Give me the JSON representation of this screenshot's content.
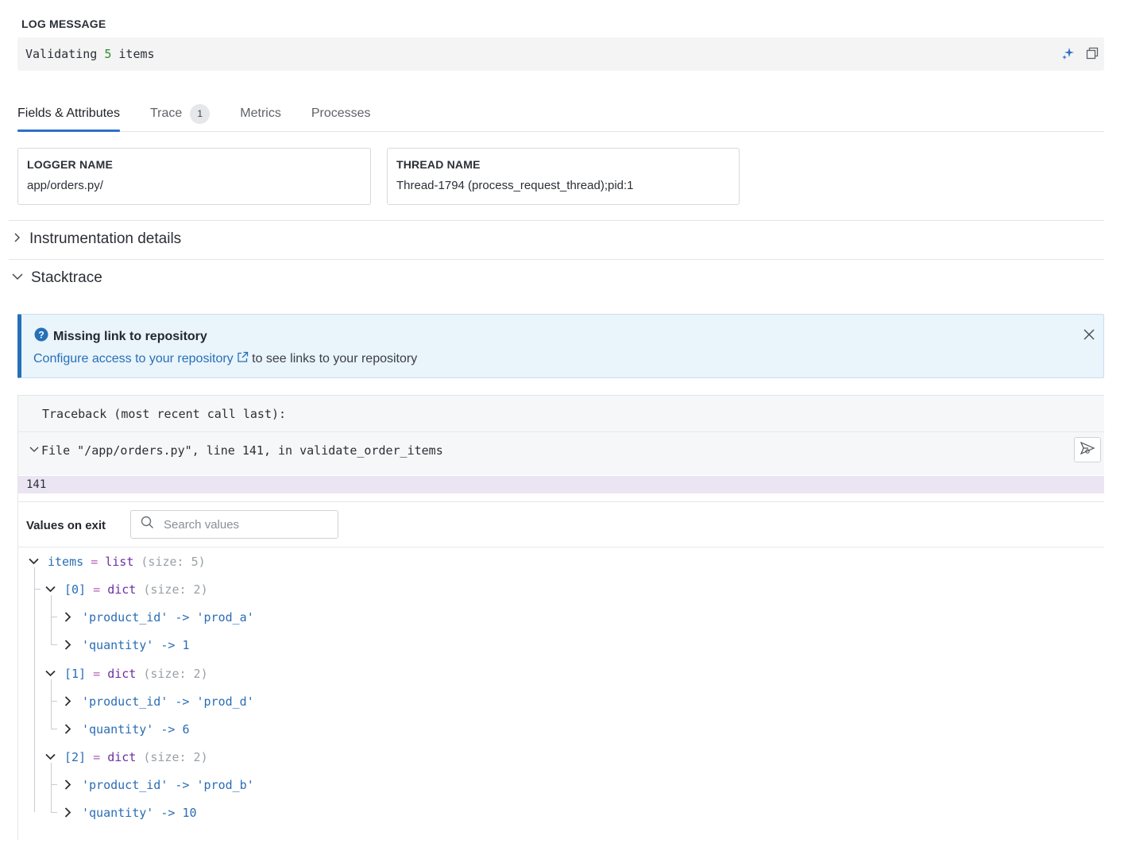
{
  "log": {
    "heading": "LOG MESSAGE",
    "prefix": "Validating ",
    "count": "5",
    "suffix": " items",
    "actions": [
      "sparkle-icon",
      "copy-icon"
    ]
  },
  "tabs": [
    {
      "label": "Fields & Attributes",
      "active": true
    },
    {
      "label": "Trace",
      "badge": "1"
    },
    {
      "label": "Metrics"
    },
    {
      "label": "Processes"
    }
  ],
  "fields": {
    "logger": {
      "label": "LOGGER NAME",
      "value": "app/orders.py/"
    },
    "thread": {
      "label": "THREAD NAME",
      "value": "Thread-1794 (process_request_thread);pid:1"
    }
  },
  "sections": {
    "instrumentation": "Instrumentation details",
    "stacktrace": "Stacktrace"
  },
  "banner": {
    "title": "Missing link to repository",
    "link": "Configure access to your repository",
    "rest": " to see links to your repository"
  },
  "stack": {
    "traceback": "Traceback (most recent call last):",
    "file": "File \"/app/orders.py\", line 141, in validate_order_items",
    "line_no": "141",
    "values_label": "Values on exit",
    "search_placeholder": "Search values"
  },
  "tree": {
    "root": {
      "name": "items",
      "eq": "=",
      "type": "list",
      "meta": "(size: 5)"
    },
    "entries": [
      {
        "index": "[0]",
        "eq": "=",
        "type": "dict",
        "meta": "(size: 2)",
        "kv": [
          {
            "key": "'product_id'",
            "arrow": "->",
            "val": "'prod_a'"
          },
          {
            "key": "'quantity'",
            "arrow": "->",
            "val": "1"
          }
        ]
      },
      {
        "index": "[1]",
        "eq": "=",
        "type": "dict",
        "meta": "(size: 2)",
        "kv": [
          {
            "key": "'product_id'",
            "arrow": "->",
            "val": "'prod_d'"
          },
          {
            "key": "'quantity'",
            "arrow": "->",
            "val": "6"
          }
        ]
      },
      {
        "index": "[2]",
        "eq": "=",
        "type": "dict",
        "meta": "(size: 2)",
        "kv": [
          {
            "key": "'product_id'",
            "arrow": "->",
            "val": "'prod_b'"
          },
          {
            "key": "'quantity'",
            "arrow": "->",
            "val": "10"
          }
        ]
      }
    ]
  },
  "colors": {
    "accent": "#2f6fc9",
    "banner_border": "#2570b8",
    "highlight_line": "#ebe4f3"
  }
}
